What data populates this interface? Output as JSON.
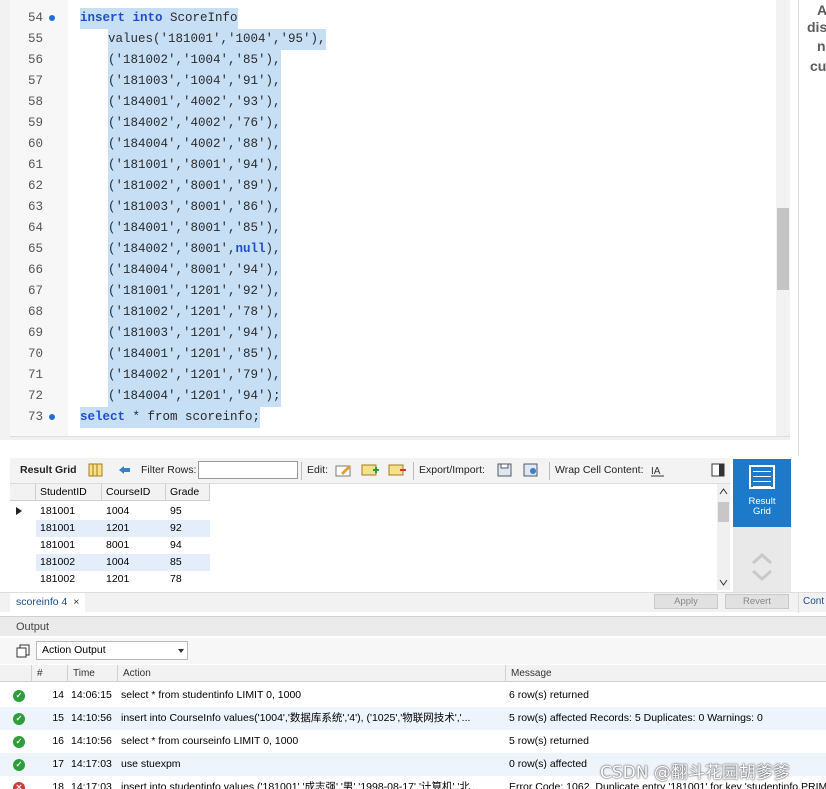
{
  "editor": {
    "lines": [
      {
        "n": "54",
        "dot": true,
        "indent": false,
        "kw": "insert into",
        "rest": " ScoreInfo",
        "tail": ""
      },
      {
        "n": "55",
        "dot": false,
        "indent": true,
        "kw": "",
        "rest": "values('181001','1004','95'),",
        "tail": ""
      },
      {
        "n": "56",
        "dot": false,
        "indent": true,
        "kw": "",
        "rest": "('181002','1004','85'),",
        "tail": ""
      },
      {
        "n": "57",
        "dot": false,
        "indent": true,
        "kw": "",
        "rest": "('181003','1004','91'),",
        "tail": ""
      },
      {
        "n": "58",
        "dot": false,
        "indent": true,
        "kw": "",
        "rest": "('184001','4002','93'),",
        "tail": ""
      },
      {
        "n": "59",
        "dot": false,
        "indent": true,
        "kw": "",
        "rest": "('184002','4002','76'),",
        "tail": ""
      },
      {
        "n": "60",
        "dot": false,
        "indent": true,
        "kw": "",
        "rest": "('184004','4002','88'),",
        "tail": ""
      },
      {
        "n": "61",
        "dot": false,
        "indent": true,
        "kw": "",
        "rest": "('181001','8001','94'),",
        "tail": ""
      },
      {
        "n": "62",
        "dot": false,
        "indent": true,
        "kw": "",
        "rest": "('181002','8001','89'),",
        "tail": ""
      },
      {
        "n": "63",
        "dot": false,
        "indent": true,
        "kw": "",
        "rest": "('181003','8001','86'),",
        "tail": ""
      },
      {
        "n": "64",
        "dot": false,
        "indent": true,
        "kw": "",
        "rest": "('184001','8001','85'),",
        "tail": ""
      },
      {
        "n": "65",
        "dot": false,
        "indent": true,
        "kw": "",
        "rest": "('184002','8001',",
        "tail": "null"
      },
      {
        "n": "66",
        "dot": false,
        "indent": true,
        "kw": "",
        "rest": "('184004','8001','94'),",
        "tail": ""
      },
      {
        "n": "67",
        "dot": false,
        "indent": true,
        "kw": "",
        "rest": "('181001','1201','92'),",
        "tail": ""
      },
      {
        "n": "68",
        "dot": false,
        "indent": true,
        "kw": "",
        "rest": "('181002','1201','78'),",
        "tail": ""
      },
      {
        "n": "69",
        "dot": false,
        "indent": true,
        "kw": "",
        "rest": "('181003','1201','94'),",
        "tail": ""
      },
      {
        "n": "70",
        "dot": false,
        "indent": true,
        "kw": "",
        "rest": "('184001','1201','85'),",
        "tail": ""
      },
      {
        "n": "71",
        "dot": false,
        "indent": true,
        "kw": "",
        "rest": "('184002','1201','79'),",
        "tail": ""
      },
      {
        "n": "72",
        "dot": false,
        "indent": true,
        "kw": "",
        "rest": "('184004','1201','94');",
        "tail": ""
      },
      {
        "n": "73",
        "dot": true,
        "indent": false,
        "kw": "select",
        "rest": " * from scoreinfo;",
        "tail": ""
      }
    ]
  },
  "right_panel": {
    "lines": [
      "A",
      "dis",
      "n",
      "cu"
    ]
  },
  "toolbar": {
    "result_grid": "Result Grid",
    "filter_rows": "Filter Rows:",
    "filter_value": "",
    "edit": "Edit:",
    "export_import": "Export/Import:",
    "wrap": "Wrap Cell Content:"
  },
  "result_button": {
    "label1": "Result",
    "label2": "Grid"
  },
  "grid": {
    "columns": [
      "StudentID",
      "CourseID",
      "Grade"
    ],
    "rows": [
      [
        "181001",
        "1004",
        "95"
      ],
      [
        "181001",
        "1201",
        "92"
      ],
      [
        "181001",
        "8001",
        "94"
      ],
      [
        "181002",
        "1004",
        "85"
      ],
      [
        "181002",
        "1201",
        "78"
      ]
    ]
  },
  "tabs": {
    "scoreinfo": "scoreinfo 4",
    "close": "×",
    "apply": "Apply",
    "revert": "Revert",
    "cont": "Cont"
  },
  "output": {
    "header": "Output",
    "selector": "Action Output",
    "columns": [
      "#",
      "Time",
      "Action",
      "Message"
    ],
    "rows": [
      {
        "status": "ok",
        "n": "14",
        "time": "14:06:15",
        "action": "select * from studentinfo LIMIT 0, 1000",
        "message": "6 row(s) returned"
      },
      {
        "status": "ok",
        "n": "15",
        "time": "14:10:56",
        "action": "insert into CourseInfo values('1004','数据库系统','4'),     ('1025','物联网技术','...",
        "message": "5 row(s) affected Records: 5  Duplicates: 0  Warnings: 0"
      },
      {
        "status": "ok",
        "n": "16",
        "time": "14:10:56",
        "action": "select * from courseinfo LIMIT 0, 1000",
        "message": "5 row(s) returned"
      },
      {
        "status": "ok",
        "n": "17",
        "time": "14:17:03",
        "action": "use stuexpm",
        "message": "0 row(s) affected"
      },
      {
        "status": "err",
        "n": "18",
        "time": "14:17:03",
        "action": "insert into studentinfo values ('181001','成志强','男','1998-08-17','计算机','北...",
        "message": "Error Code: 1062. Duplicate entry '181001' for key 'studentinfo.PRIM"
      }
    ]
  },
  "watermark": "CSDN @翻斗花园胡爹爹",
  "colors": {
    "selection": "#c7dff5",
    "keyword": "#1f4ec9",
    "accent": "#1d79c9",
    "ok": "#2d9e3a",
    "error": "#c93a3a"
  }
}
